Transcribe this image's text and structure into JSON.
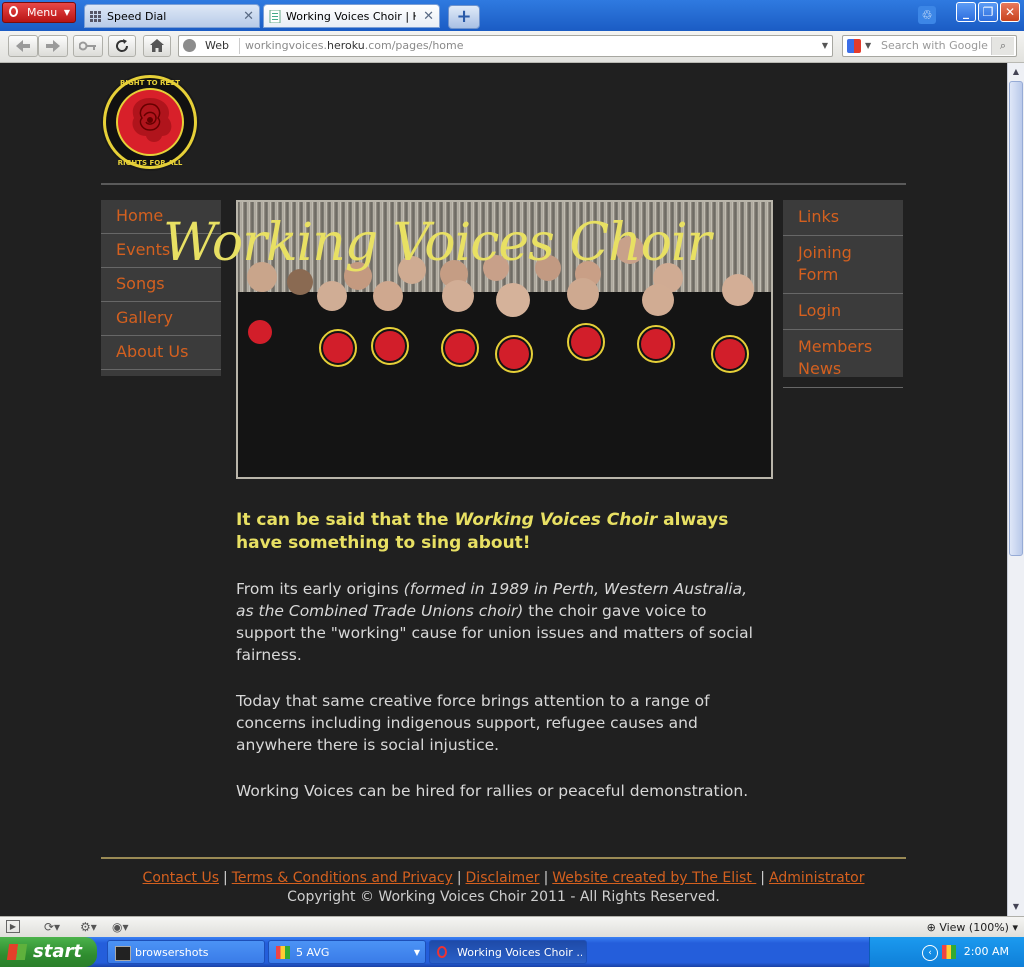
{
  "browser": {
    "menu_label": "Menu",
    "tabs": [
      {
        "title": "Speed Dial",
        "active": false
      },
      {
        "title": "Working Voices Choir | H...",
        "active": true
      }
    ],
    "new_tab_glyph": "+",
    "address": {
      "mode_label": "Web",
      "url_pre": "workingvoices.",
      "url_host": "heroku",
      "url_post": ".com/pages/home"
    },
    "search_placeholder": "Search with Google",
    "status": {
      "zoom_label": "View (100%)"
    }
  },
  "site": {
    "logo_alt": "Right to work, right to rest, right to play, rights for all — rose emblem",
    "title": "Working Voices Choir",
    "left_nav": [
      {
        "label": "Home"
      },
      {
        "label": "Events"
      },
      {
        "label": "Songs"
      },
      {
        "label": "Gallery"
      },
      {
        "label": "About Us"
      }
    ],
    "right_nav": [
      {
        "label": "Links"
      },
      {
        "label": "Joining Form"
      },
      {
        "label": "Login"
      },
      {
        "label": "Members News"
      }
    ],
    "lead": {
      "pre": "It can be said that the ",
      "em": "Working Voices Choir",
      "post": " always have something to sing about!"
    },
    "para1": {
      "pre": "From its early origins ",
      "em": "(formed in 1989 in Perth, Western Australia, as the Combined Trade Unions choir)",
      "post": " the choir gave voice to support the \"working\" cause for union issues and matters of social fairness."
    },
    "para2": "Today that same creative force brings attention to a range of concerns including indigenous support, refugee causes and anywhere there is social injustice.",
    "para3": "Working Voices can be hired for rallies or peaceful demonstration.",
    "footer_links": [
      {
        "label": "Contact Us"
      },
      {
        "label": "Terms & Conditions and Privacy"
      },
      {
        "label": "Disclaimer"
      },
      {
        "label": "Website created by The Elist "
      },
      {
        "label": "Administrator"
      }
    ],
    "copyright": "Copyright © Working Voices Choir 2011 - All Rights Reserved."
  },
  "taskbar": {
    "start_label": "start",
    "items": [
      {
        "label": "browsershots"
      },
      {
        "label": "5 AVG"
      },
      {
        "label": "Working Voices Choir ..."
      }
    ],
    "clock": "2:00 AM"
  },
  "colors": {
    "page_bg": "#202020",
    "nav_bg": "#3b3b3b",
    "link_orange": "#d4601f",
    "heading_yellow": "#e8e063"
  }
}
